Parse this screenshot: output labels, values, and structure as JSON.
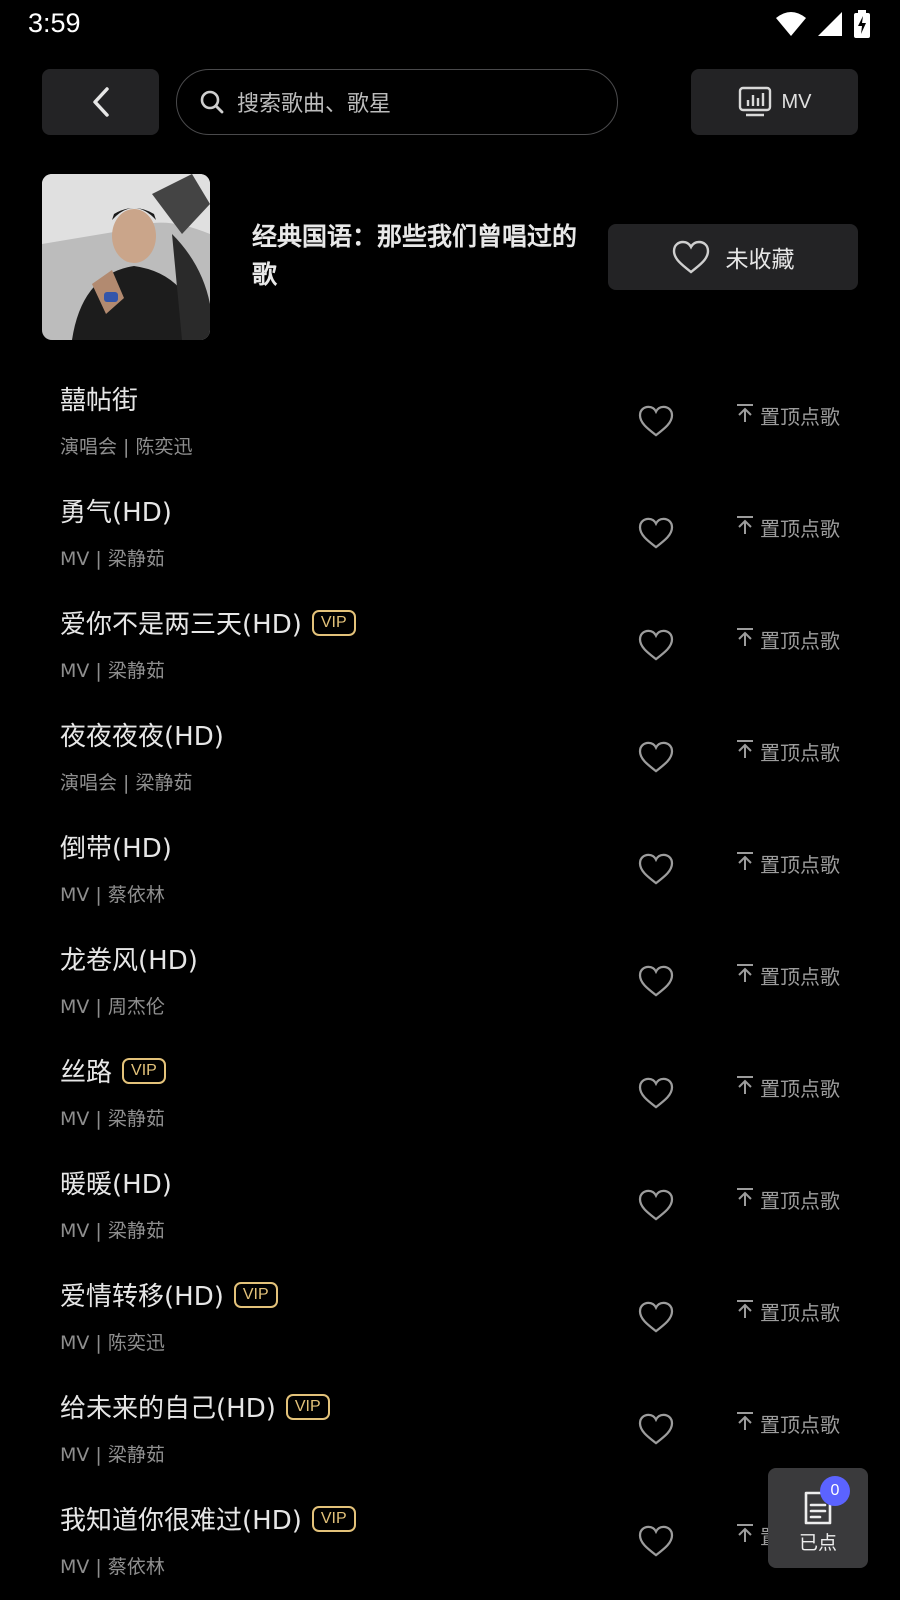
{
  "status_bar": {
    "time": "3:59"
  },
  "search": {
    "placeholder": "搜索歌曲、歌星"
  },
  "mv_button": {
    "label": "MV"
  },
  "playlist": {
    "title": "经典国语：那些我们曾唱过的歌",
    "favorite_label": "未收藏"
  },
  "pin_label": "置顶点歌",
  "vip_label": "VIP",
  "songs": [
    {
      "title": "囍帖街",
      "subtitle": "演唱会 | 陈奕迅",
      "vip": false
    },
    {
      "title": "勇气(HD)",
      "subtitle": "MV | 梁静茹",
      "vip": false
    },
    {
      "title": "爱你不是两三天(HD)",
      "subtitle": "MV | 梁静茹",
      "vip": true
    },
    {
      "title": "夜夜夜夜(HD)",
      "subtitle": "演唱会 | 梁静茹",
      "vip": false
    },
    {
      "title": "倒带(HD)",
      "subtitle": "MV | 蔡依林",
      "vip": false
    },
    {
      "title": "龙卷风(HD)",
      "subtitle": "MV | 周杰伦",
      "vip": false
    },
    {
      "title": "丝路",
      "subtitle": "MV | 梁静茹",
      "vip": true
    },
    {
      "title": "暖暖(HD)",
      "subtitle": "MV | 梁静茹",
      "vip": false
    },
    {
      "title": "爱情转移(HD)",
      "subtitle": "MV | 陈奕迅",
      "vip": true
    },
    {
      "title": "给未来的自己(HD)",
      "subtitle": "MV | 梁静茹",
      "vip": true
    },
    {
      "title": "我知道你很难过(HD)",
      "subtitle": "MV | 蔡依林",
      "vip": true
    }
  ],
  "queue": {
    "label": "已点",
    "count": "0"
  },
  "colors": {
    "background": "#000000",
    "button_bg": "#232325",
    "vip_gold": "#e3c27a",
    "badge_blue": "#5b63ff"
  }
}
